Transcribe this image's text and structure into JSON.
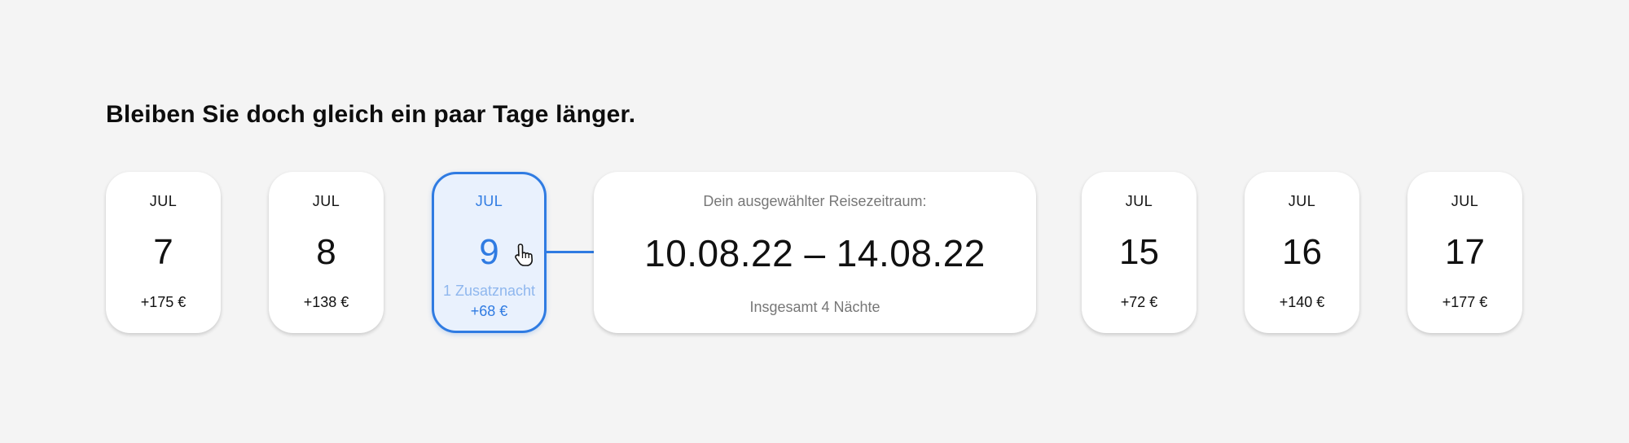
{
  "headline": "Bleiben Sie doch gleich ein paar Tage länger.",
  "accent_color": "#2f7be2",
  "cards_before": [
    {
      "month": "JUL",
      "day": "7",
      "price": "+175 €"
    },
    {
      "month": "JUL",
      "day": "8",
      "price": "+138 €"
    }
  ],
  "selected_card": {
    "month": "JUL",
    "day": "9",
    "extra": "1 Zusatznacht",
    "price": "+68 €"
  },
  "range": {
    "label": "Dein ausgewählter Reisezeitraum:",
    "dates": "10.08.22 – 14.08.22",
    "total": "Insgesamt 4 Nächte"
  },
  "cards_after": [
    {
      "month": "JUL",
      "day": "15",
      "price": "+72 €"
    },
    {
      "month": "JUL",
      "day": "16",
      "price": "+140 €"
    },
    {
      "month": "JUL",
      "day": "17",
      "price": "+177 €"
    }
  ],
  "icons": {
    "cursor": "hand-pointer-icon"
  }
}
